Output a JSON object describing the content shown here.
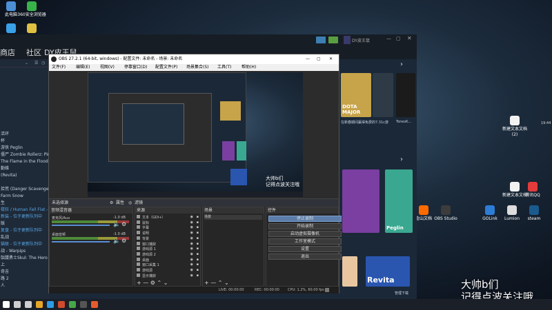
{
  "desktop": {
    "icons_left": [
      {
        "label": "此电脑",
        "color": "#4d90d6"
      },
      {
        "label": "360安全浏览器",
        "color": "#38b34a"
      },
      {
        "label": "",
        "color": "#3aa0e8"
      },
      {
        "label": "",
        "color": "#e0c040"
      }
    ],
    "icons_right": [
      {
        "label": "新建文本文档 (2)",
        "color": "#f2f2f2"
      },
      {
        "label": "新建文本文档",
        "color": "#f2f2f2"
      },
      {
        "label": "腾讯QQ",
        "color": "#e23b3b"
      },
      {
        "label": "金山文档",
        "color": "#ff6a00"
      },
      {
        "label": "OBS Studio",
        "color": "#3c3c3c"
      },
      {
        "label": "GOLink",
        "color": "#2d7cd6"
      },
      {
        "label": "Lumion",
        "color": "#dddddd"
      },
      {
        "label": "steam",
        "color": "#1b5a8c"
      }
    ],
    "overlay_text_line1": "大帅b们",
    "overlay_text_line2": "记得点波关注哦",
    "preview_overlay_line1": "大帅b们",
    "preview_overlay_line2": "记得点波关注哦"
  },
  "steam": {
    "nav_items": [
      "商店",
      "社区",
      "DY皮王鼠"
    ],
    "user_name": "DY皮王鼠",
    "games": [
      {
        "label": "活环",
        "style": "normal"
      },
      {
        "label": "杯",
        "style": "normal"
      },
      {
        "label": "游侠 Peglin",
        "style": "normal"
      },
      {
        "label": "僵尸 Zombie Rollerz: Pinball",
        "style": "normal"
      },
      {
        "label": "The Flame in the Flood",
        "style": "normal"
      },
      {
        "label": "勤维",
        "style": "normal"
      },
      {
        "label": "(Revita)",
        "style": "normal"
      },
      {
        "label": "",
        "style": "normal"
      },
      {
        "label": "拾荒 (Danger Scavenger)",
        "style": "normal"
      },
      {
        "label": "Farm Snow",
        "style": "normal"
      },
      {
        "label": "生",
        "style": "normal"
      },
      {
        "label": "楼狂 / Human Fall Flat - 位于更新队列中",
        "style": "blue"
      },
      {
        "label": "新装 - 位于更新队列中",
        "style": "blue"
      },
      {
        "label": "版",
        "style": "normal"
      },
      {
        "label": "复盘 - 位于更新队列中",
        "style": "blue"
      },
      {
        "label": "乱战",
        "style": "normal"
      },
      {
        "label": "猫联 - 位于更新队列中",
        "style": "blue"
      },
      {
        "label": "战 - Warpips",
        "style": "normal"
      },
      {
        "label": "骷髅勇士Skul: The Hero Slayer",
        "style": "normal"
      },
      {
        "label": "上",
        "style": "normal"
      },
      {
        "label": "奇吉",
        "style": "normal"
      },
      {
        "label": "路 2",
        "style": "normal"
      },
      {
        "label": "人",
        "style": "normal"
      }
    ],
    "cards": [
      {
        "title": "DOTA MAJOR",
        "color": "#c7a44a"
      },
      {
        "title": "Revita",
        "color": "#2a56b0"
      },
      {
        "title": "Peglin",
        "color": "#3aa890"
      }
    ],
    "card_caption": "在新春期间赢得免费的7.31c游",
    "card_caption2": "TonesK...",
    "manage_label": "管理下载",
    "date_label": "19:44"
  },
  "obs": {
    "title": "OBS 27.2.1 (64-bit, windows) - 配置文件: 未命名 - 场景: 未命名",
    "menu": [
      "文件(F)",
      "编辑(E)",
      "视图(V)",
      "停靠窗口(D)",
      "配置文件(P)",
      "场景集合(S)",
      "工具(T)",
      "帮助(H)"
    ],
    "source_bar_label": "未选择源",
    "source_bar_props": "属性",
    "source_bar_filters": "滤镜",
    "docks": {
      "mixer_title": "音频混音器",
      "sources_title": "来源",
      "scenes_title": "场景",
      "controls_title": "控件"
    },
    "mixer_channels": [
      {
        "name": "麦克风/Aux",
        "db": "-1.0 dB"
      },
      {
        "name": "桌面音频",
        "db": "-1.0 dB"
      }
    ],
    "sources": [
      "文本（GDI+）",
      "鼠标",
      "字幕",
      "说明",
      "背景",
      "窗口捕获",
      "游戏源 1",
      "游戏源 2",
      "桌面",
      "窗口采集 1",
      "游戏源",
      "显示捕获"
    ],
    "scenes": [
      "场景"
    ],
    "controls": [
      "停止录制",
      "开始录制",
      "启动虚拟摄像机",
      "工作室模式",
      "设置",
      "退出"
    ],
    "status": {
      "live": "LIVE: 00:00:00",
      "rec": "REC: 00:00:00",
      "cpu": "CPU: 1.2%, 60.00 fps"
    }
  },
  "taskbar": {
    "apps": [
      {
        "name": "start",
        "color": "#ffffff"
      },
      {
        "name": "search",
        "color": "#cfcfcf"
      },
      {
        "name": "task-view",
        "color": "#cfcfcf"
      },
      {
        "name": "app1",
        "color": "#e8a628"
      },
      {
        "name": "app2",
        "color": "#2f9be6"
      },
      {
        "name": "app3",
        "color": "#d24a2d"
      },
      {
        "name": "app4",
        "color": "#46a84a"
      },
      {
        "name": "app5",
        "color": "#555"
      },
      {
        "name": "app6",
        "color": "#e55b2d"
      }
    ]
  }
}
